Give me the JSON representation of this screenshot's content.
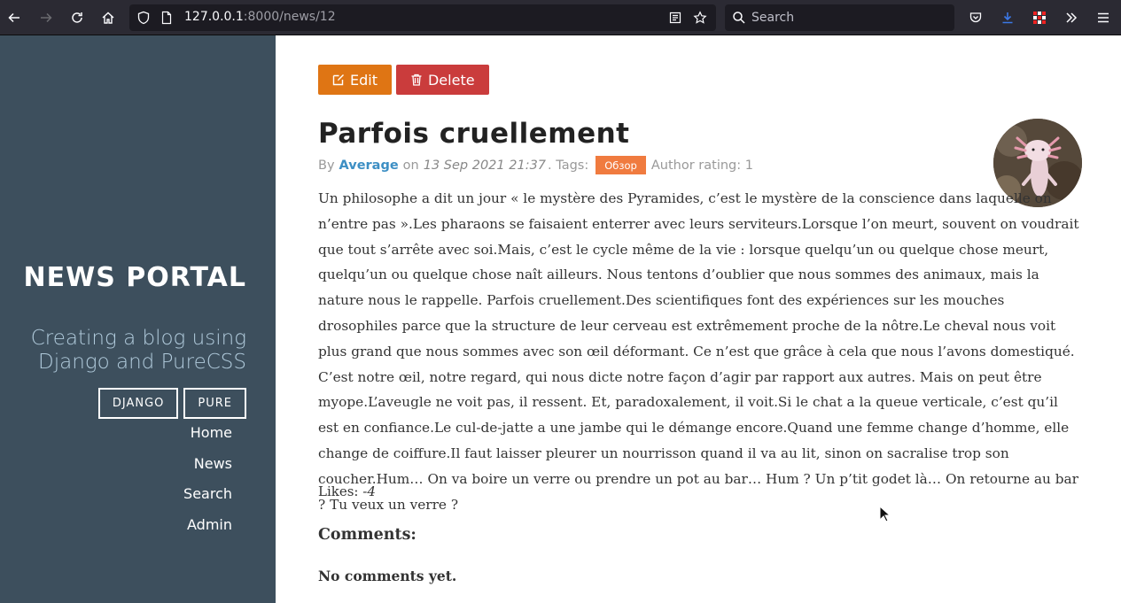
{
  "browser": {
    "url_host": "127.0.0.1",
    "url_rest": ":8000/news/12",
    "search_placeholder": "Search"
  },
  "sidebar": {
    "title": "NEWS PORTAL",
    "tagline": "Creating a blog using Django and PureCSS",
    "buttons": [
      "DJANGO",
      "PURE"
    ],
    "nav": [
      "Home",
      "News",
      "Search",
      "Admin"
    ]
  },
  "post": {
    "edit_label": "Edit",
    "delete_label": "Delete",
    "title": "Parfois cruellement",
    "by_label": "By",
    "author": "Average",
    "on_label": "on",
    "date": "13 Sep 2021 21:37",
    "tags_label": ". Tags:",
    "tag": "Обзор",
    "rating_label": "Author rating: 1",
    "body": "Un philosophe a dit un jour « le mystère des Pyramides, c’est le mystère de la conscience dans laquelle on n’entre pas ».Les pharaons se faisaient enterrer avec leurs serviteurs.Lorsque l’on meurt, souvent on voudrait que tout s’arrête avec soi.Mais, c’est le cycle même de la vie : lorsque quelqu’un ou quelque chose meurt, quelqu’un ou quelque chose naît ailleurs. Nous tentons d’oublier que nous sommes des animaux, mais la nature nous le rappelle. Parfois cruellement.Des scientifiques font des expériences sur les mouches drosophiles parce que la structure de leur cerveau est extrêmement proche de la nôtre.Le cheval nous voit plus grand que nous sommes avec son œil déformant. Ce n’est que grâce à cela que nous l’avons domestiqué. C’est notre œil, notre regard, qui nous dicte notre façon d’agir par rapport aux autres. Mais on peut être myope.L’aveugle ne voit pas, il ressent. Et, paradoxalement, il voit.Si le chat a la queue verticale, c’est qu’il est en confiance.Le cul-de-jatte a une jambe qui le démange encore.Quand une femme change d’homme, elle change de coiffure.Il faut laisser pleurer un nourrisson quand il va au lit, sinon on sacralise trop son coucher.Hum… On va boire un verre ou prendre un pot au bar… Hum ? Un p’tit godet là… On retourne au bar ? Tu veux un verre ?",
    "likes_label": "Likes:",
    "likes_value": "-4",
    "comments_heading": "Comments:",
    "no_comments": "No comments yet."
  }
}
